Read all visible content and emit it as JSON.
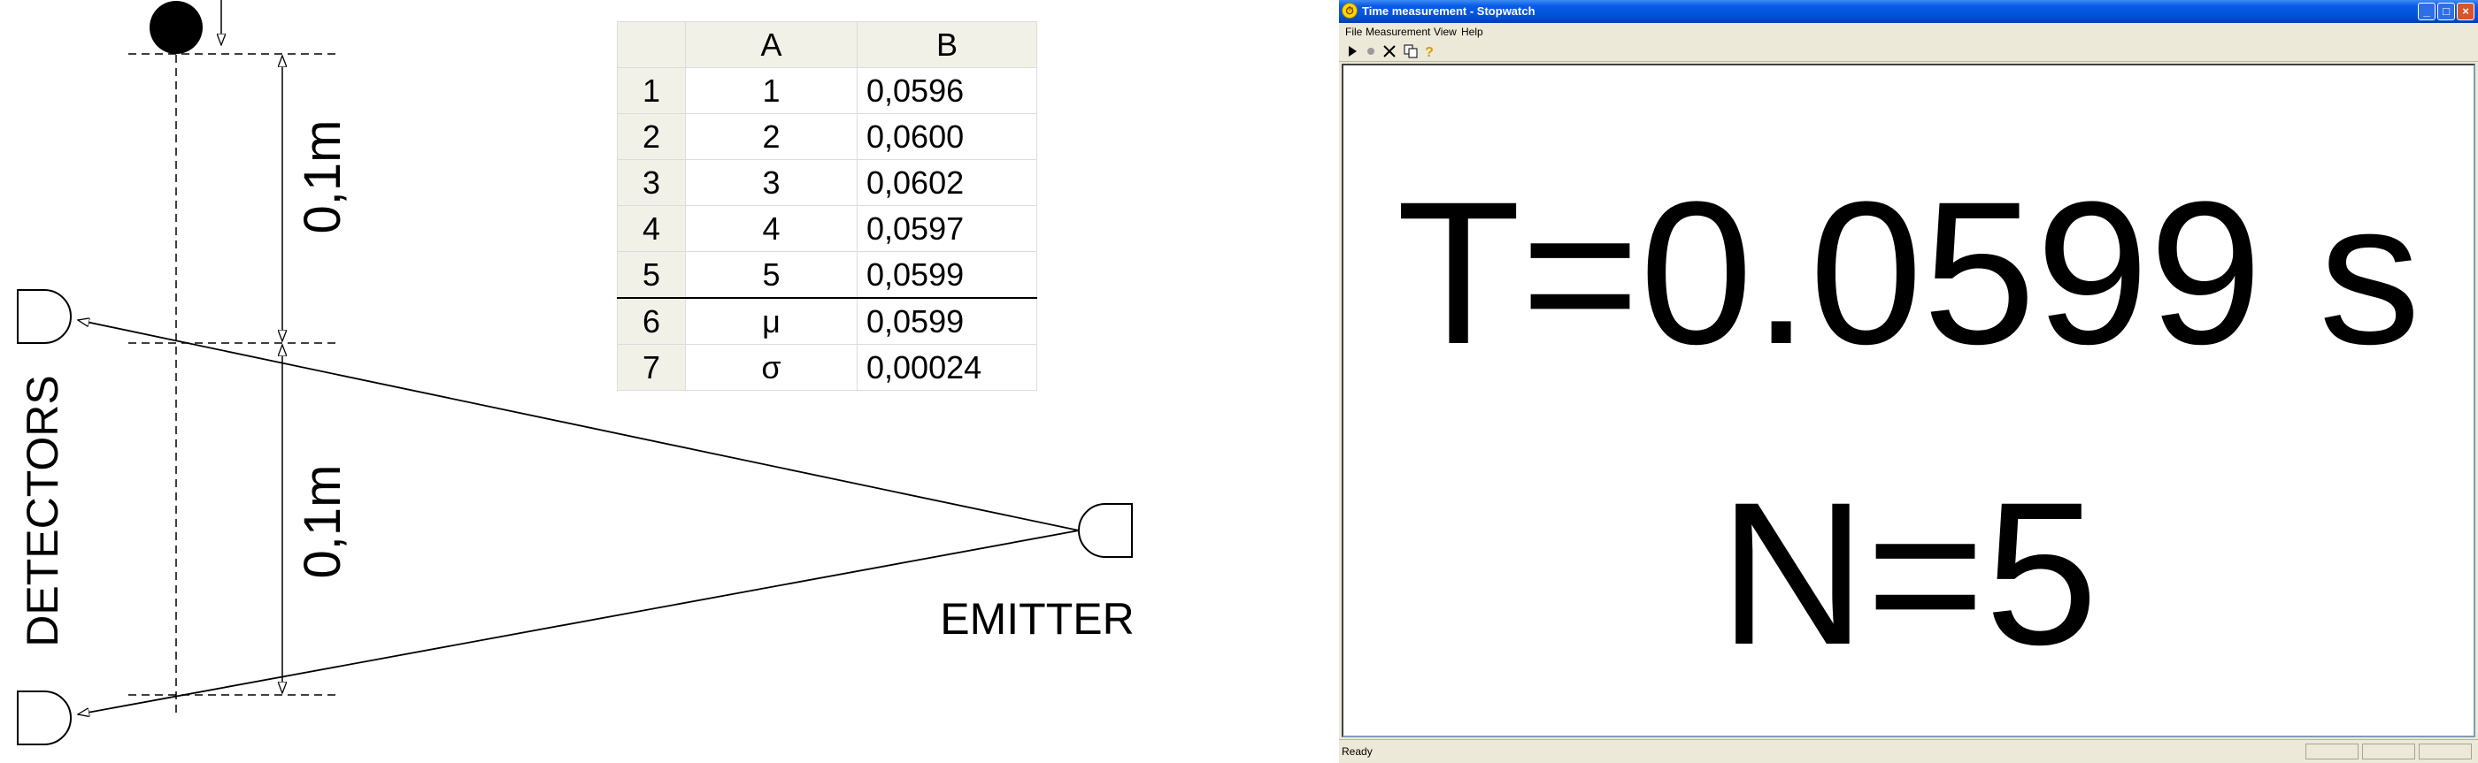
{
  "diagram": {
    "distance_label_top": "0,1m",
    "distance_label_bottom": "0,1m",
    "detectors_label": "DETECTORS",
    "emitter_label": "EMITTER"
  },
  "table": {
    "columns": [
      "A",
      "B"
    ],
    "rows": [
      {
        "num": "1",
        "a": "1",
        "b": "0,0596"
      },
      {
        "num": "2",
        "a": "2",
        "b": "0,0600"
      },
      {
        "num": "3",
        "a": "3",
        "b": "0,0602"
      },
      {
        "num": "4",
        "a": "4",
        "b": "0,0597"
      },
      {
        "num": "5",
        "a": "5",
        "b": "0,0599"
      },
      {
        "num": "6",
        "a": "μ",
        "b": "0,0599"
      },
      {
        "num": "7",
        "a": "σ",
        "b": "0,00024"
      }
    ]
  },
  "window": {
    "title": "Time measurement - Stopwatch",
    "menu": [
      "File",
      "Measurement",
      "View",
      "Help"
    ],
    "toolbar_icons": [
      "play-icon",
      "record-icon",
      "clear-icon",
      "copy-icon",
      "help-icon"
    ],
    "time_readout": "T=0.0599 s",
    "count_readout": "N=5",
    "status": "Ready",
    "titlebar_color": "#0a5ce8"
  }
}
